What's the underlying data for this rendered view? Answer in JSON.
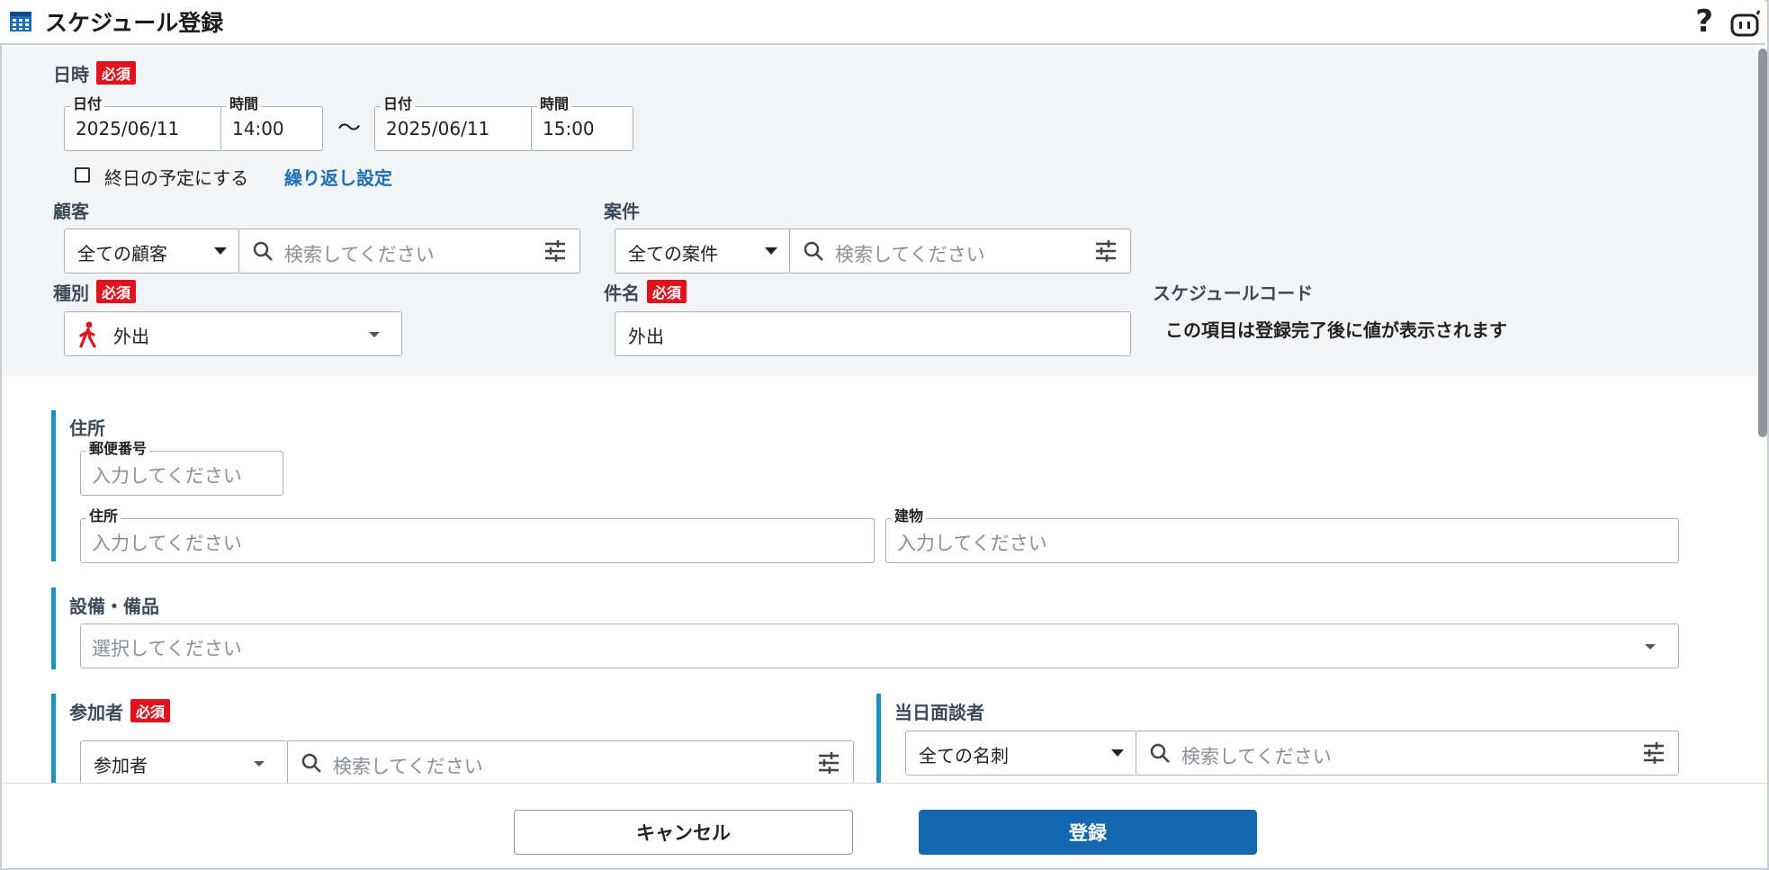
{
  "window": {
    "title": "スケジュール登録",
    "help_label": "?"
  },
  "datetime": {
    "label": "日時",
    "required": "必須",
    "start_date_label": "日付",
    "start_date": "2025/06/11",
    "start_time_label": "時間",
    "start_time": "14:00",
    "separator": "〜",
    "end_date_label": "日付",
    "end_date": "2025/06/11",
    "end_time_label": "時間",
    "end_time": "15:00",
    "allday_label": "終日の予定にする",
    "repeat_link": "繰り返し設定"
  },
  "customer": {
    "label": "顧客",
    "filter": "全ての顧客",
    "search_placeholder": "検索してください"
  },
  "project": {
    "label": "案件",
    "filter": "全ての案件",
    "search_placeholder": "検索してください"
  },
  "type": {
    "label": "種別",
    "required": "必須",
    "value": "外出"
  },
  "subject": {
    "label": "件名",
    "required": "必須",
    "value": "外出"
  },
  "schedule_code": {
    "label": "スケジュールコード",
    "note": "この項目は登録完了後に値が表示されます"
  },
  "address": {
    "label": "住所",
    "zip_label": "郵便番号",
    "zip_placeholder": "入力してください",
    "address_label": "住所",
    "address_placeholder": "入力してください",
    "building_label": "建物",
    "building_placeholder": "入力してください"
  },
  "equipment": {
    "label": "設備・備品",
    "placeholder": "選択してください"
  },
  "participants": {
    "label": "参加者",
    "required": "必須",
    "filter": "参加者",
    "search_placeholder": "検索してください"
  },
  "interviewee": {
    "label": "当日面談者",
    "filter": "全ての名刺",
    "search_placeholder": "検索してください"
  },
  "footer": {
    "cancel_label": "キャンセル",
    "submit_label": "登録"
  },
  "colors": {
    "accent": "#1468b0",
    "required_badge": "#e0141e",
    "section_bar": "#1e8fb8",
    "link": "#1a6fb5"
  }
}
